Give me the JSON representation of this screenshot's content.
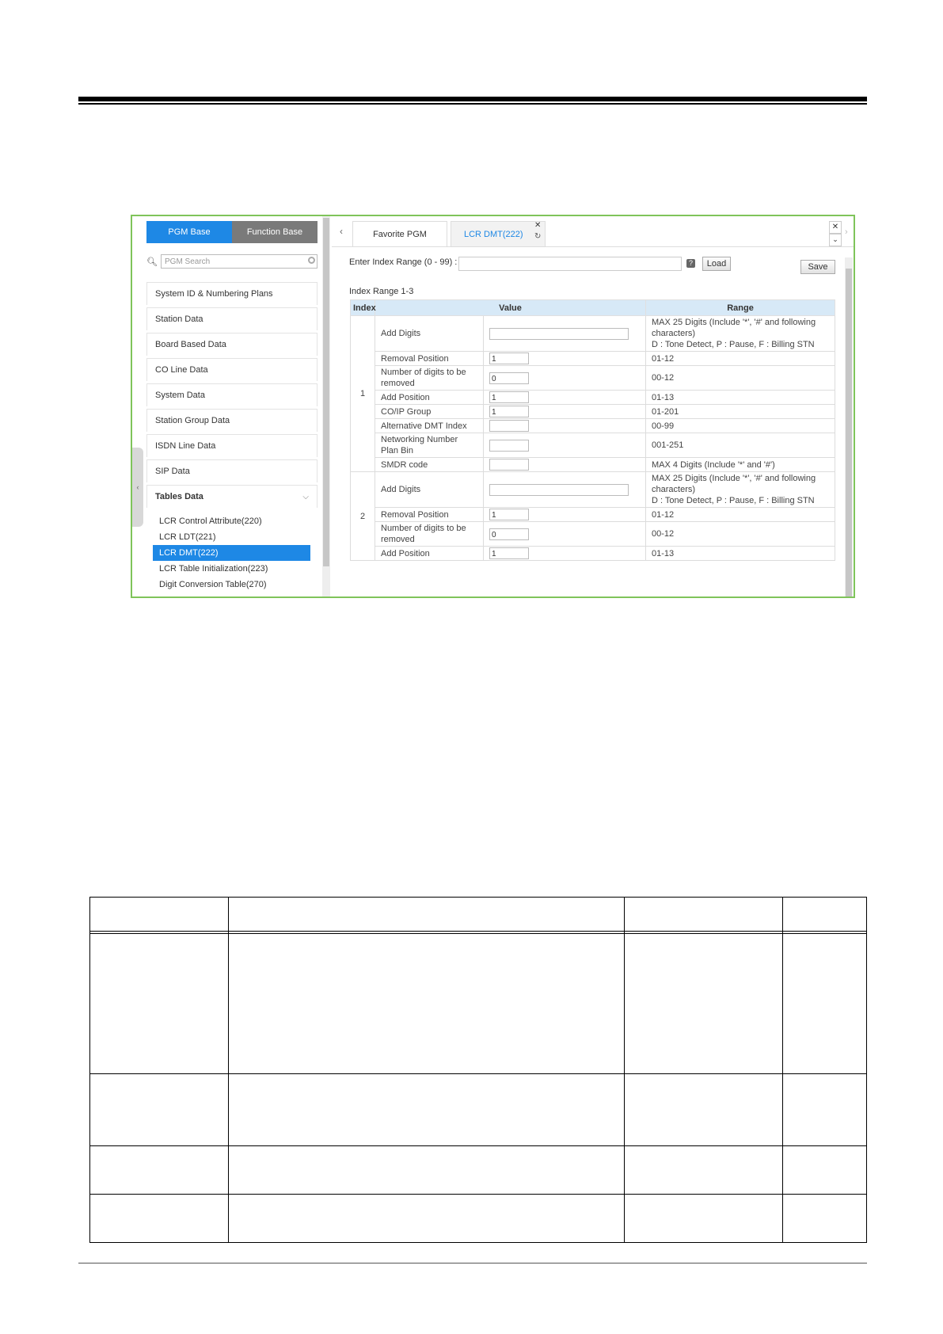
{
  "left": {
    "tabs": [
      "PGM Base",
      "Function Base"
    ],
    "search_placeholder": "PGM Search",
    "menu": [
      "System ID & Numbering Plans",
      "Station Data",
      "Board Based Data",
      "CO Line Data",
      "System Data",
      "Station Group Data",
      "ISDN Line Data",
      "SIP Data"
    ],
    "open_menu": "Tables Data",
    "submenu": [
      "LCR Control Attribute(220)",
      "LCR LDT(221)",
      "LCR DMT(222)",
      "LCR Table Initialization(223)",
      "Digit Conversion Table(270)"
    ],
    "active_submenu_index": 2
  },
  "tabs": {
    "favorite": "Favorite PGM",
    "current": "LCR DMT(222)"
  },
  "form": {
    "range_label": "Enter Index Range (0 - 99) :",
    "load": "Load",
    "save": "Save",
    "index_range": "Index Range 1-3"
  },
  "grid": {
    "headers": [
      "Index",
      "Value",
      "Range"
    ],
    "groups": [
      {
        "index": "1",
        "rows": [
          {
            "label": "Add Digits",
            "value": "",
            "wide": true,
            "range": "MAX 25 Digits (Include '*', '#' and following characters)\nD : Tone Detect, P : Pause, F : Billing STN"
          },
          {
            "label": "Removal Position",
            "value": "1",
            "range": "01-12"
          },
          {
            "label": "Number of digits to be removed",
            "value": "0",
            "range": "00-12"
          },
          {
            "label": "Add Position",
            "value": "1",
            "range": "01-13"
          },
          {
            "label": "CO/IP Group",
            "value": "1",
            "range": "01-201"
          },
          {
            "label": "Alternative DMT Index",
            "value": "",
            "range": "00-99"
          },
          {
            "label": "Networking Number Plan Bin",
            "value": "",
            "range": "001-251"
          },
          {
            "label": "SMDR code",
            "value": "",
            "range": "MAX 4 Digits (Include '*' and '#')"
          }
        ]
      },
      {
        "index": "2",
        "rows": [
          {
            "label": "Add Digits",
            "value": "",
            "wide": true,
            "range": "MAX 25 Digits (Include '*', '#' and following characters)\nD : Tone Detect, P : Pause, F : Billing STN"
          },
          {
            "label": "Removal Position",
            "value": "1",
            "range": "01-12"
          },
          {
            "label": "Number of digits to be removed",
            "value": "0",
            "range": "00-12"
          },
          {
            "label": "Add Position",
            "value": "1",
            "range": "01-13"
          }
        ]
      }
    ]
  }
}
